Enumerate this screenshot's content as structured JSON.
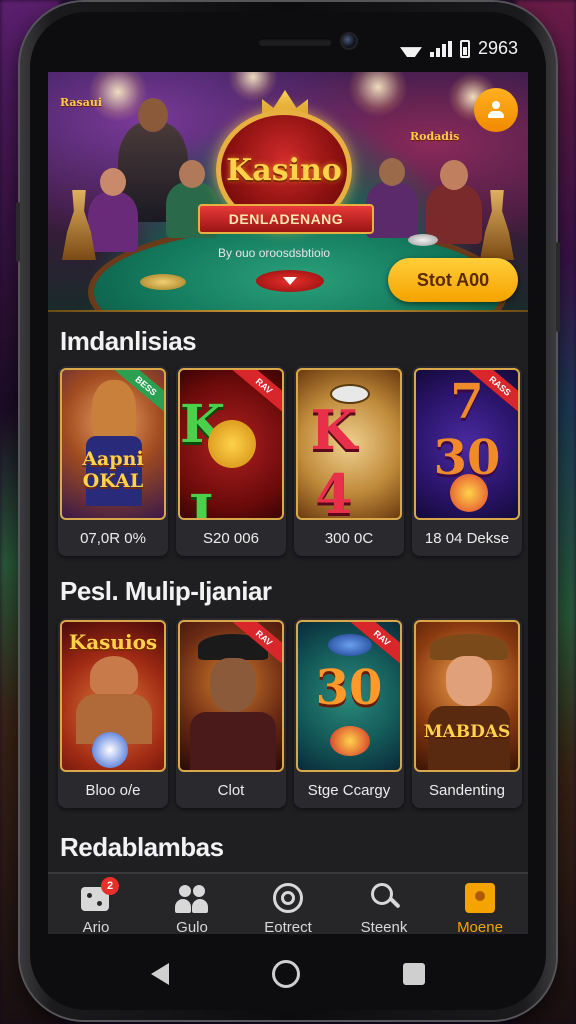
{
  "status_bar": {
    "clock": "2963",
    "icons": [
      "wifi-icon",
      "signal-icon",
      "battery-icon"
    ]
  },
  "banner": {
    "logo_title": "Kasino",
    "logo_ribbon": "DENLADENANG",
    "caption": "By ouo oroosdsbtioio",
    "badge_left": "Rasaui",
    "badge_right": "Rodadis",
    "start_label": "Stot A00",
    "profile_icon": "user-icon"
  },
  "sections": [
    {
      "title": "Imdanlisias",
      "games": [
        {
          "label": "07,0R 0%",
          "art_text": "Aapni OKAL",
          "ribbon": "BESS"
        },
        {
          "label": "S20 006",
          "art_text": "K J",
          "ribbon": "RAV"
        },
        {
          "label": "300 0C",
          "art_text": "K 4",
          "ribbon": ""
        },
        {
          "label": "18 04 Dekse",
          "art_text": "7 30",
          "ribbon": "RASS"
        }
      ]
    },
    {
      "title": "Pesl. Mulip-Ijaniar",
      "games": [
        {
          "label": "Bloo o/e",
          "art_text": "Kasuios",
          "ribbon": ""
        },
        {
          "label": "Clot",
          "art_text": "",
          "ribbon": "RAV"
        },
        {
          "label": "Stge Ccargy",
          "art_text": "30",
          "ribbon": "RAV"
        },
        {
          "label": "Sandenting",
          "art_text": "MABDAS",
          "ribbon": ""
        }
      ]
    },
    {
      "title": "Redablambas",
      "games": []
    }
  ],
  "bottom_nav": [
    {
      "label": "Ario",
      "icon": "dice-icon",
      "badge": "2",
      "active": false
    },
    {
      "label": "Gulo",
      "icon": "group-icon",
      "badge": "",
      "active": false
    },
    {
      "label": "Eotrect",
      "icon": "chip-icon",
      "badge": "",
      "active": false
    },
    {
      "label": "Steenk",
      "icon": "search-icon",
      "badge": "",
      "active": false
    },
    {
      "label": "Moene",
      "icon": "profile-card-icon",
      "badge": "",
      "active": true
    }
  ],
  "colors": {
    "accent": "#f5a300",
    "badge": "#e8302a",
    "card_border": "#d8a84a"
  }
}
